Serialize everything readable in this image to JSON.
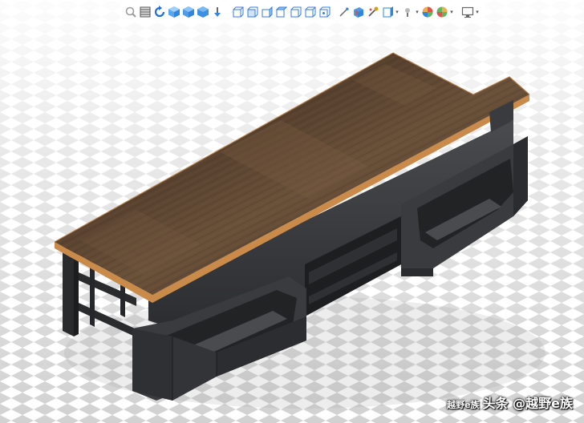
{
  "app": {
    "name": "3D CAD viewport",
    "view_mode": "isometric shaded with realview floor"
  },
  "toolbar": {
    "buttons": [
      {
        "name": "zoom-to-fit-icon",
        "color": "#9a9a9a"
      },
      {
        "name": "zoom-to-area-icon",
        "color": "#555555"
      },
      {
        "name": "previous-view-icon",
        "color": "#1f6fd6"
      },
      {
        "name": "section-view-icon",
        "color": "#2e86de"
      },
      {
        "name": "view-orientation-icon",
        "color": "#2e86de"
      },
      {
        "name": "display-style-icon",
        "color": "#2e86de"
      },
      {
        "name": "hide-show-items-icon",
        "color": "#444444"
      },
      {
        "name": "front-view-icon",
        "color": "#3a7bd5"
      },
      {
        "name": "back-view-icon",
        "color": "#3a7bd5"
      },
      {
        "name": "left-view-icon",
        "color": "#3a7bd5"
      },
      {
        "name": "right-view-icon",
        "color": "#3a7bd5"
      },
      {
        "name": "top-view-icon",
        "color": "#3a7bd5"
      },
      {
        "name": "bottom-view-icon",
        "color": "#3a7bd5"
      },
      {
        "name": "normal-to-icon",
        "color": "#3a7bd5"
      },
      {
        "name": "edit-appearance-icon",
        "color": "#666666"
      },
      {
        "name": "apply-scene-icon",
        "color": "#2e86de"
      },
      {
        "name": "view-settings-icon",
        "color": "#d4a017"
      },
      {
        "name": "shaded-edges-icon",
        "color": "#2e86de"
      },
      {
        "name": "lights-icon",
        "color": "#777777"
      },
      {
        "name": "appearances-icon",
        "color": "#d9534f"
      },
      {
        "name": "scene-icon",
        "color": "#5cb85c"
      },
      {
        "name": "display-monitor-icon",
        "color": "#666666"
      }
    ]
  },
  "model": {
    "top_color": "#5b4430",
    "edge_color": "#c98a4a",
    "body_color": "#3c3d3f",
    "dark_color": "#1e1f21",
    "frame_color": "#2a2b2d"
  },
  "watermark": {
    "small": "越野e族",
    "main": "头条 @越野e族"
  }
}
